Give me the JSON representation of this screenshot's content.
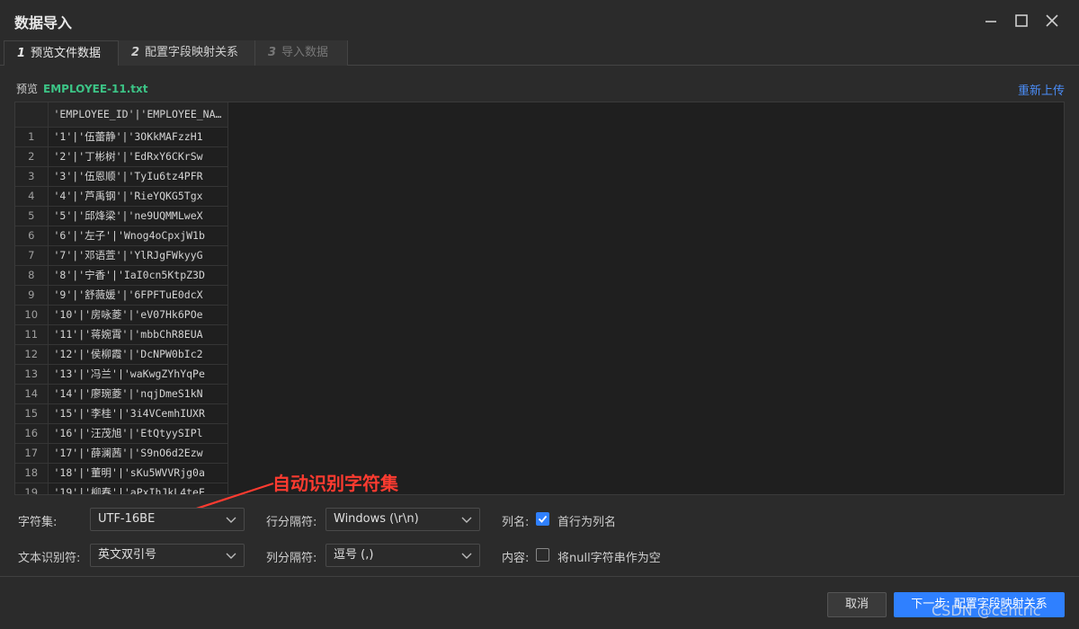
{
  "window": {
    "title": "数据导入"
  },
  "tabs": [
    {
      "num": "1",
      "label": "预览文件数据",
      "state": "active"
    },
    {
      "num": "2",
      "label": "配置字段映射关系",
      "state": "normal"
    },
    {
      "num": "3",
      "label": "导入数据",
      "state": "disabled"
    }
  ],
  "preview": {
    "label": "预览",
    "file": "EMPLOYEE-11.txt",
    "reupload": "重新上传"
  },
  "grid": {
    "header": "'EMPLOYEE_ID'|'EMPLOYEE_NAME'",
    "rows": [
      {
        "n": "1",
        "v": "'1'|'伍蕾静'|'3OKkMAFzzH1"
      },
      {
        "n": "2",
        "v": "'2'|'丁彬树'|'EdRxY6CKrSw"
      },
      {
        "n": "3",
        "v": "'3'|'伍恩顺'|'TyIu6tz4PFR"
      },
      {
        "n": "4",
        "v": "'4'|'芦禹钢'|'RieYQKG5Tgx"
      },
      {
        "n": "5",
        "v": "'5'|'邱烽梁'|'ne9UQMMLweX"
      },
      {
        "n": "6",
        "v": "'6'|'左子'|'Wnog4oCpxjW1b"
      },
      {
        "n": "7",
        "v": "'7'|'邓语萱'|'YlRJgFWkyyG"
      },
      {
        "n": "8",
        "v": "'8'|'宁香'|'IaI0cn5KtpZ3D"
      },
      {
        "n": "9",
        "v": "'9'|'舒薇媛'|'6FPFTuE0dcX"
      },
      {
        "n": "10",
        "v": "'10'|'房咏菱'|'eV07Hk6POe"
      },
      {
        "n": "11",
        "v": "'11'|'蒋婉霄'|'mbbChR8EUA"
      },
      {
        "n": "12",
        "v": "'12'|'侯柳霞'|'DcNPW0bIc2"
      },
      {
        "n": "13",
        "v": "'13'|'冯兰'|'waKwgZYhYqPe"
      },
      {
        "n": "14",
        "v": "'14'|'廖琬菱'|'nqjDmeS1kN"
      },
      {
        "n": "15",
        "v": "'15'|'李桂'|'3i4VCemhIUXR"
      },
      {
        "n": "16",
        "v": "'16'|'汪茂旭'|'EtQtyySIPl"
      },
      {
        "n": "17",
        "v": "'17'|'薛澜茜'|'S9nO6d2Ezw"
      },
      {
        "n": "18",
        "v": "'18'|'董明'|'sKu5WVVRjg0a"
      },
      {
        "n": "19",
        "v": "'19'|'柳春'|'aPxIhJkL4teE"
      }
    ]
  },
  "annotation": "自动识别字符集",
  "form": {
    "charset_label": "字符集:",
    "charset_value": "UTF-16BE",
    "text_qualifier_label": "文本识别符:",
    "text_qualifier_value": "英文双引号",
    "row_sep_label": "行分隔符:",
    "row_sep_value": "Windows (\\r\\n)",
    "col_sep_label": "列分隔符:",
    "col_sep_value": "逗号 (,)",
    "colname_label": "列名:",
    "colname_option": "首行为列名",
    "content_label": "内容:",
    "content_option": "将null字符串作为空"
  },
  "footer": {
    "cancel": "取消",
    "next": "下一步: 配置字段映射关系"
  },
  "watermark": "CSDN @centric",
  "colors": {
    "accent": "#2f80ff",
    "file": "#3cc486",
    "annotation": "#ff3b30",
    "link": "#4b8df8"
  }
}
